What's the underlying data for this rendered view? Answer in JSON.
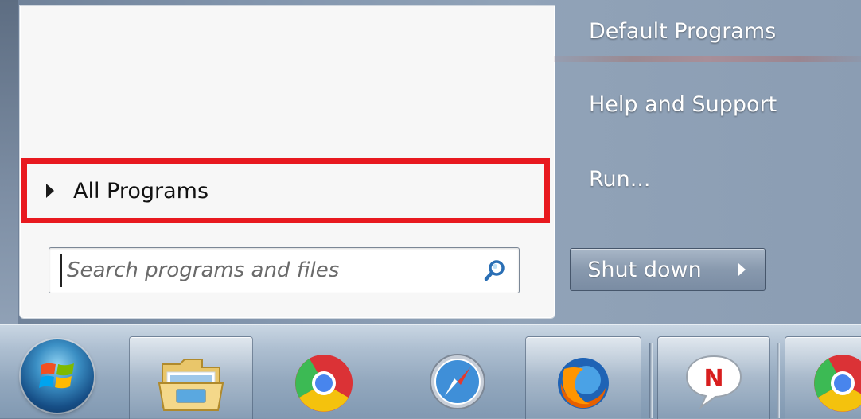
{
  "left_pane": {
    "all_programs_label": "All Programs",
    "search": {
      "placeholder": "Search programs and files",
      "value": ""
    }
  },
  "right_pane": {
    "items": [
      {
        "label": "Default Programs"
      },
      {
        "label": "Help and Support"
      },
      {
        "label": "Run..."
      }
    ],
    "shutdown_label": "Shut down"
  },
  "taskbar": {
    "buttons": [
      {
        "icon": "windows-explorer-icon"
      },
      {
        "icon": "chrome-icon"
      },
      {
        "icon": "safari-icon"
      },
      {
        "icon": "firefox-icon"
      },
      {
        "icon": "n-chat-icon"
      },
      {
        "icon": "chrome-icon"
      }
    ]
  },
  "colors": {
    "highlight_border": "#e8191f",
    "menu_text": "#ffffff"
  }
}
